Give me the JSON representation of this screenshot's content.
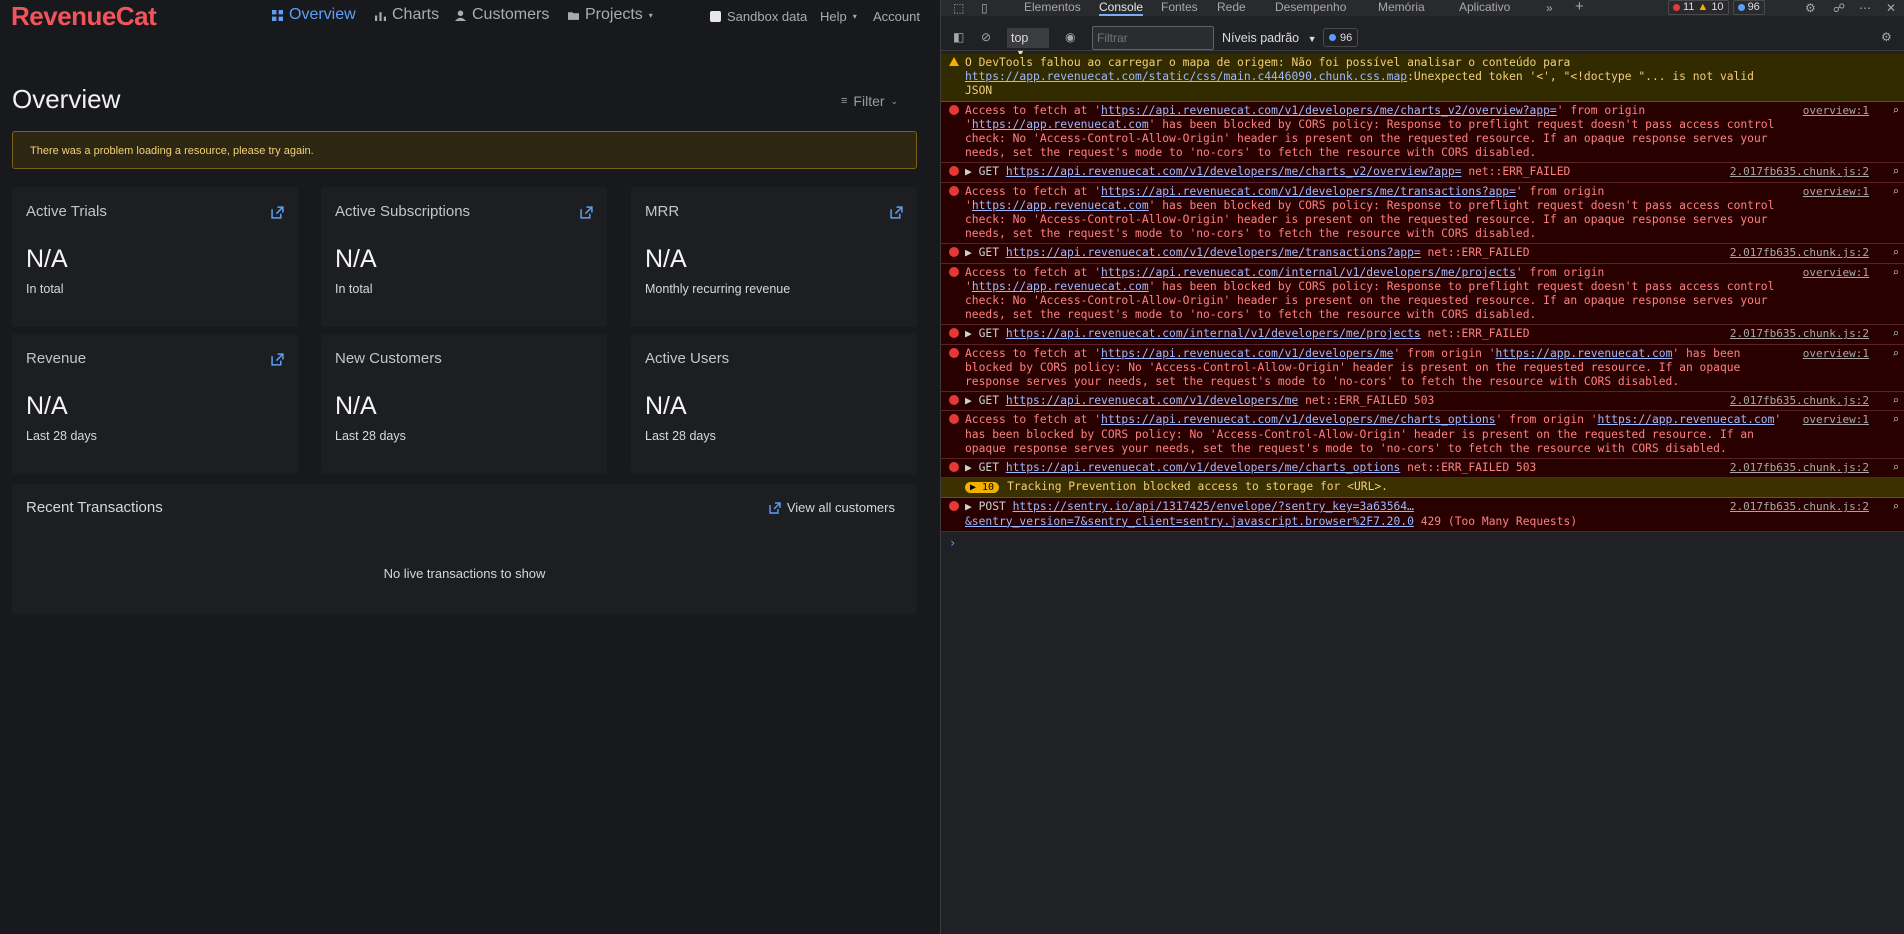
{
  "app": {
    "logo": "RevenueCat",
    "nav": [
      {
        "label": "Overview",
        "icon": "grid-icon",
        "active": true
      },
      {
        "label": "Charts",
        "icon": "bar-chart-icon",
        "active": false
      },
      {
        "label": "Customers",
        "icon": "person-icon",
        "active": false
      },
      {
        "label": "Projects",
        "icon": "folder-icon",
        "active": false
      }
    ],
    "sandbox_label": "Sandbox data",
    "help_label": "Help",
    "account_label": "Account",
    "page_title": "Overview",
    "filter_label": "Filter",
    "alert_text": "There was a problem loading a resource, please try again.",
    "cards": [
      {
        "title": "Active Trials",
        "value": "N/A",
        "sub": "In total",
        "link": true
      },
      {
        "title": "Active Subscriptions",
        "value": "N/A",
        "sub": "In total",
        "link": true
      },
      {
        "title": "MRR",
        "value": "N/A",
        "sub": "Monthly recurring revenue",
        "link": true
      },
      {
        "title": "Revenue",
        "value": "N/A",
        "sub": "Last 28 days",
        "link": true
      },
      {
        "title": "New Customers",
        "value": "N/A",
        "sub": "Last 28 days",
        "link": false
      },
      {
        "title": "Active Users",
        "value": "N/A",
        "sub": "Last 28 days",
        "link": false
      }
    ],
    "recent_title": "Recent Transactions",
    "view_all_label": "View all customers",
    "empty_text": "No live transactions to show"
  },
  "devtools": {
    "tabs": [
      "Elementos",
      "Console",
      "Fontes",
      "Rede",
      "Desempenho",
      "Memória",
      "Aplicativo"
    ],
    "active_tab": "Console",
    "counts": {
      "errors": "11",
      "warnings": "10",
      "messages": "96"
    },
    "context": "top",
    "filter_placeholder": "Filtrar",
    "levels_label": "Níveis padrão",
    "toolbar_count": "96",
    "messages": [
      {
        "type": "warn",
        "parts": [
          {
            "t": "O DevTools falhou ao carregar o mapa de origem: Não foi possível analisar o conteúdo para "
          },
          {
            "t": "https://app.revenuecat.com/static/css/main.c4446090.chunk.css.map",
            "link": true
          },
          {
            "t": ":Unexpected token '<', \"<!doctype \"... is not valid JSON"
          }
        ],
        "src": ""
      },
      {
        "type": "err",
        "parts": [
          {
            "t": "Access to fetch at '"
          },
          {
            "t": "https://api.revenuecat.com/v1/developers/me/charts_v2/overview?app=",
            "link": true
          },
          {
            "t": "' from origin '"
          },
          {
            "t": "https://app.revenuecat.com",
            "link": true
          },
          {
            "t": "' has been blocked by CORS policy: Response to preflight request doesn't pass access control check: No 'Access-Control-Allow-Origin' header is present on the requested resource. If an opaque response serves your needs, set the request's mode to 'no-cors' to fetch the resource with CORS disabled."
          }
        ],
        "src": "overview:1"
      },
      {
        "type": "err",
        "get": true,
        "parts": [
          {
            "t": "GET "
          },
          {
            "t": "https://api.revenuecat.com/v1/developers/me/charts_v2/overview?app=",
            "link": true
          },
          {
            "t": " net::ERR_FAILED"
          }
        ],
        "src": "2.017fb635.chunk.js:2"
      },
      {
        "type": "err",
        "parts": [
          {
            "t": "Access to fetch at '"
          },
          {
            "t": "https://api.revenuecat.com/v1/developers/me/transactions?app=",
            "link": true
          },
          {
            "t": "' from origin '"
          },
          {
            "t": "https://app.revenuecat.com",
            "link": true
          },
          {
            "t": "' has been blocked by CORS policy: Response to preflight request doesn't pass access control check: No 'Access-Control-Allow-Origin' header is present on the requested resource. If an opaque response serves your needs, set the request's mode to 'no-cors' to fetch the resource with CORS disabled."
          }
        ],
        "src": "overview:1"
      },
      {
        "type": "err",
        "get": true,
        "parts": [
          {
            "t": "GET "
          },
          {
            "t": "https://api.revenuecat.com/v1/developers/me/transactions?app=",
            "link": true
          },
          {
            "t": " net::ERR_FAILED"
          }
        ],
        "src": "2.017fb635.chunk.js:2"
      },
      {
        "type": "err",
        "parts": [
          {
            "t": "Access to fetch at '"
          },
          {
            "t": "https://api.revenuecat.com/internal/v1/developers/me/projects",
            "link": true
          },
          {
            "t": "' from origin '"
          },
          {
            "t": "https://app.revenuecat.com",
            "link": true
          },
          {
            "t": "' has been blocked by CORS policy: Response to preflight request doesn't pass access control check: No 'Access-Control-Allow-Origin' header is present on the requested resource. If an opaque response serves your needs, set the request's mode to 'no-cors' to fetch the resource with CORS disabled."
          }
        ],
        "src": "overview:1"
      },
      {
        "type": "err",
        "get": true,
        "parts": [
          {
            "t": "GET "
          },
          {
            "t": "https://api.revenuecat.com/internal/v1/developers/me/projects",
            "link": true
          },
          {
            "t": " net::ERR_FAILED"
          }
        ],
        "src": "2.017fb635.chunk.js:2"
      },
      {
        "type": "err",
        "parts": [
          {
            "t": "Access to fetch at '"
          },
          {
            "t": "https://api.revenuecat.com/v1/developers/me",
            "link": true
          },
          {
            "t": "' from origin '"
          },
          {
            "t": "https://app.revenuecat.com",
            "link": true
          },
          {
            "t": "' has been blocked by CORS policy: No 'Access-Control-Allow-Origin' header is present on the requested resource. If an opaque response serves your needs, set the request's mode to 'no-cors' to fetch the resource with CORS disabled."
          }
        ],
        "src": "overview:1"
      },
      {
        "type": "err",
        "get": true,
        "parts": [
          {
            "t": "GET "
          },
          {
            "t": "https://api.revenuecat.com/v1/developers/me",
            "link": true
          },
          {
            "t": " net::ERR_FAILED 503"
          }
        ],
        "src": "2.017fb635.chunk.js:2"
      },
      {
        "type": "err",
        "parts": [
          {
            "t": "Access to fetch at '"
          },
          {
            "t": "https://api.revenuecat.com/v1/developers/me/charts_options",
            "link": true
          },
          {
            "t": "' from origin '"
          },
          {
            "t": "https://app.revenuecat.com",
            "link": true
          },
          {
            "t": "' has been blocked by CORS policy: No 'Access-Control-Allow-Origin' header is present on the requested resource. If an opaque response serves your needs, set the request's mode to 'no-cors' to fetch the resource with CORS disabled."
          }
        ],
        "src": "overview:1"
      },
      {
        "type": "err",
        "get": true,
        "parts": [
          {
            "t": "GET "
          },
          {
            "t": "https://api.revenuecat.com/v1/developers/me/charts_options",
            "link": true
          },
          {
            "t": " net::ERR_FAILED 503"
          }
        ],
        "src": "2.017fb635.chunk.js:2"
      },
      {
        "type": "info",
        "count": "10",
        "parts": [
          {
            "t": "Tracking Prevention blocked access to storage for <URL>."
          }
        ],
        "src": ""
      },
      {
        "type": "err",
        "get": true,
        "parts": [
          {
            "t": "POST "
          },
          {
            "t": "https://sentry.io/api/1317425/envelope/?sentry_key=3a63564…&sentry_version=7&sentry_client=sentry.javascript.browser%2F7.20.0",
            "link": true
          },
          {
            "t": " 429 (Too Many Requests)"
          }
        ],
        "src": "2.017fb635.chunk.js:2"
      }
    ],
    "prompt_symbol": "›"
  }
}
